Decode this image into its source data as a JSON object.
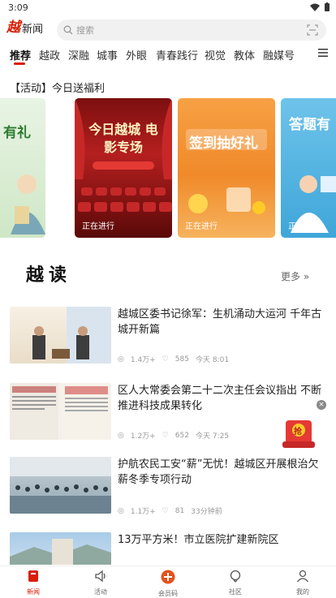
{
  "status_bar": {
    "time": "3:09"
  },
  "header": {
    "logo_mark": "越",
    "logo_text": "新闻",
    "search_placeholder": "搜索"
  },
  "tabs": [
    "推荐",
    "越政",
    "深融",
    "城事",
    "外眼",
    "青春践行",
    "视觉",
    "教体",
    "融媒号"
  ],
  "section_title": "【活动】今日送福利",
  "cards": [
    {
      "big": "有礼",
      "status": ""
    },
    {
      "big": "今日越城 电影专场",
      "status": "正在进行"
    },
    {
      "big": "签到抽好礼",
      "status": "正在进行"
    },
    {
      "big": "答题有",
      "status": "正在进行"
    }
  ],
  "yuedu": {
    "title": "越读",
    "more": "更多 »"
  },
  "news": [
    {
      "title": "越城区委书记徐军：生机涌动大运河 千年古城开新篇",
      "views": "1.4万+",
      "likes": "585",
      "time": "今天 8:01"
    },
    {
      "title": "区人大常委会第二十二次主任会议指出 不断推进科技成果转化",
      "views": "1.2万+",
      "likes": "652",
      "time": "今天 7:25"
    },
    {
      "title": "护航农民工安“薪”无忧！越城区开展根治欠薪冬季专项行动",
      "views": "1.1万+",
      "likes": "81",
      "time": "33分钟前"
    },
    {
      "title": "13万平方米！市立医院扩建新院区",
      "views": "",
      "likes": "",
      "time": ""
    }
  ],
  "float": {
    "close": "×",
    "badge": "抢"
  },
  "bottom_nav": [
    "新闻",
    "活动",
    "会员码",
    "社区",
    "我的"
  ],
  "colors": {
    "accent": "#d81e06"
  }
}
